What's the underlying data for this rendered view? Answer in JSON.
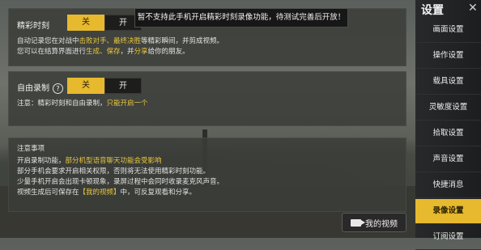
{
  "tooltip": "暂不支持此手机开启精彩时刻录像功能，待测试完善后开放！",
  "highlight": {
    "title": "精彩时刻",
    "on_label": "关",
    "off_label": "开",
    "desc1": {
      "p1": "自动记录您在对战中",
      "h1": "击败对手、最终决胜",
      "p2": "等精彩瞬间，并剪成视频。"
    },
    "desc2": {
      "p1": "您可以在结算界面进行",
      "h1": "生成、保存",
      "p2": "，并",
      "h2": "分享",
      "p3": "给你的朋友。"
    }
  },
  "free_record": {
    "title": "自由录制",
    "help_icon": "?",
    "on_label": "关",
    "off_label": "开",
    "note": {
      "p1": "注意：精彩时刻和自由录制，",
      "h1": "只能开启一个"
    }
  },
  "notes": {
    "title": "注意事项",
    "line1": {
      "p1": "开启录制功能，",
      "h1": "部分机型语音聊天功能会受影响"
    },
    "line2": "部分手机会要求开启相关权限，否则将无法使用精彩时刻功能。",
    "line3": "少量手机开启会出现卡顿现象，录屏过程中会同时收录麦克风声音。",
    "line4": {
      "p1": "视频生成后可保存在",
      "h1": "【我的视频】",
      "p2": "中，可反复观看和分享。"
    }
  },
  "my_video_button": "我的视频",
  "sidebar": {
    "title": "设置",
    "close": "✕",
    "items": [
      "画面设置",
      "操作设置",
      "载具设置",
      "灵敏度设置",
      "拾取设置",
      "声音设置",
      "快捷消息",
      "录像设置",
      "订阅设置"
    ],
    "active_index": 7
  },
  "colors": {
    "accent": "#e7b92e",
    "highlight_text": "#e7c640"
  }
}
